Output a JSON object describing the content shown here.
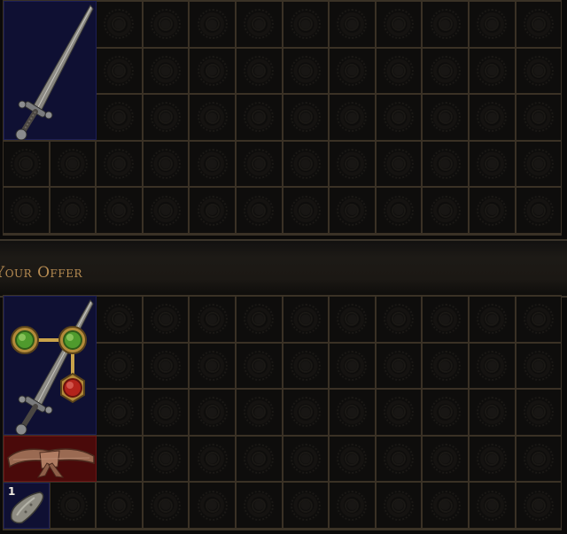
{
  "offer_section": {
    "title": "Your Offer"
  },
  "items": {
    "vendor_sword": {
      "icon": "longsword-icon",
      "rarity_color": "#0f1033"
    },
    "offer_sword": {
      "icon": "longsword-icon",
      "rarity_color": "#0f1033",
      "sockets": [
        "green",
        "green",
        "red"
      ]
    },
    "offer_belt": {
      "icon": "leather-belt-icon",
      "rarity_color": "#4a0a0a"
    },
    "offer_currency": {
      "icon": "whetstone-icon",
      "stack_count": "1"
    }
  },
  "colors": {
    "title": "#b78c52",
    "grid_line": "#3a3125",
    "normal_item_bg": "#0f1033",
    "magic_item_bg": "#4a0a0a"
  }
}
